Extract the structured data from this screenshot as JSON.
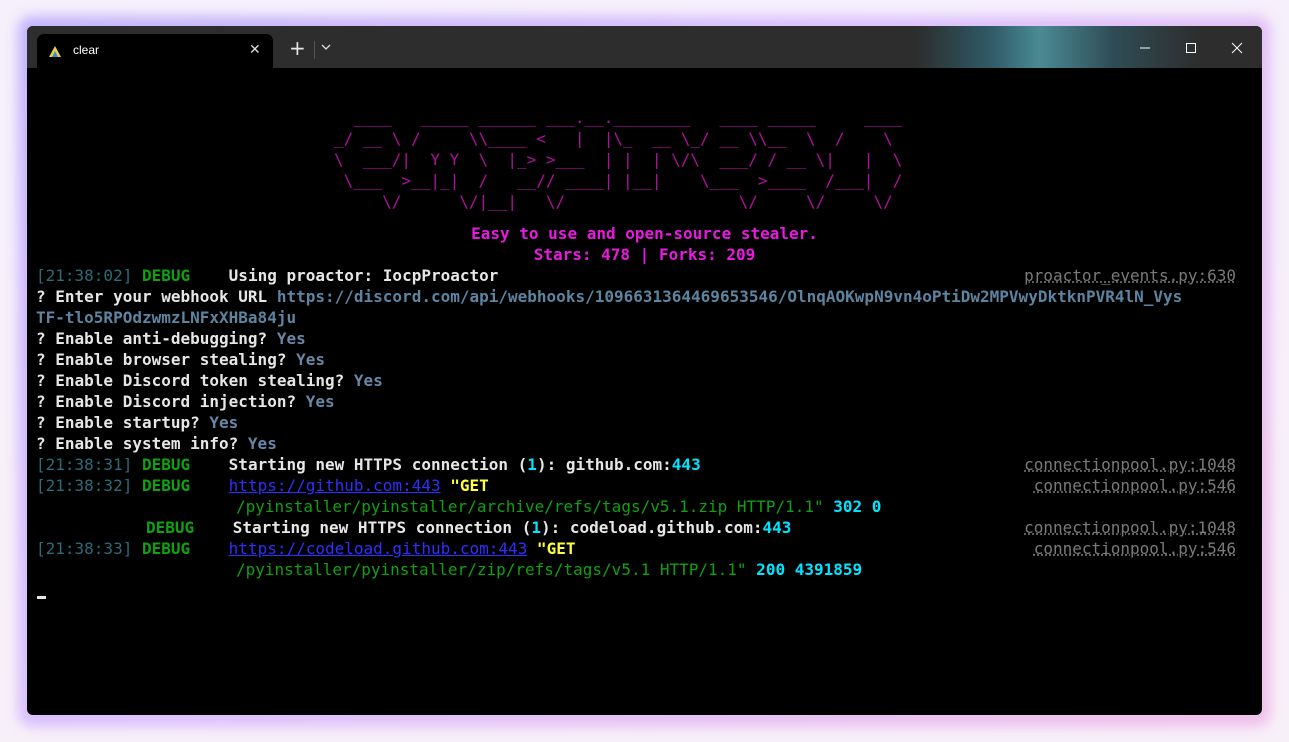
{
  "window": {
    "tab_title": "clear",
    "tab_close": "✕",
    "new_tab": "+"
  },
  "banner": {
    "ascii": [
      "  ____   _____ ______ ___.__.________   ____ _____     ____  ",
      "_/ __ \\ /     \\\\____ <   |  |\\_  __ \\_/ __ \\\\__  \\  /    \\ ",
      "\\  ___/|  Y Y  \\  |_> >___  | |  | \\/\\  ___/ / __ \\|   |  \\",
      " \\___  >__|_|  /   __// ____| |__|    \\___  >____  /___|  /",
      "     \\/      \\/|__|   \\/                  \\/     \\/     \\/ "
    ],
    "tagline": "Easy to use and open-source stealer.",
    "stats": "Stars: 478 | Forks: 209"
  },
  "lines": {
    "l1": {
      "ts": "[21:38:02]",
      "level": "DEBUG",
      "msg": "Using proactor: IocpProactor",
      "src": "proactor_events.py:630"
    },
    "l2": {
      "q": "? Enter your webhook URL ",
      "val": "https://discord.com/api/webhooks/1096631364469653546/OlnqAOKwpN9vn4oPtiDw2MPVwyDktknPVR4lN_Vys"
    },
    "l3": {
      "val": "TF-tlo5RPOdzwmzLNFxXHBa84ju"
    },
    "l4": {
      "q": "? Enable anti-debugging? ",
      "val": "Yes"
    },
    "l5": {
      "q": "? Enable browser stealing? ",
      "val": "Yes"
    },
    "l6": {
      "q": "? Enable Discord token stealing? ",
      "val": "Yes"
    },
    "l7": {
      "q": "? Enable Discord injection? ",
      "val": "Yes"
    },
    "l8": {
      "q": "? Enable startup? ",
      "val": "Yes"
    },
    "l9": {
      "q": "? Enable system info? ",
      "val": "Yes"
    },
    "l10": {
      "ts": "[21:38:31]",
      "level": "DEBUG",
      "msg1": "Starting new HTTPS connection (",
      "n": "1",
      "msg2": "): github.com:",
      "port": "443",
      "src": "connectionpool.py:1048"
    },
    "l11": {
      "ts": "[21:38:32]",
      "level": "DEBUG",
      "link": "https://github.com:443",
      "q": " \"",
      "get": "GET",
      "src": "connectionpool.py:546"
    },
    "l12": {
      "path": "/pyinstaller/pyinstaller/archive/refs/tags/v5.1.zip HTTP/1.1\"",
      "code": " 302 0"
    },
    "l13": {
      "level": "DEBUG",
      "msg1": "Starting new HTTPS connection (",
      "n": "1",
      "msg2": "): codeload.github.com:",
      "port": "443",
      "src": "connectionpool.py:1048"
    },
    "l14": {
      "ts": "[21:38:33]",
      "level": "DEBUG",
      "link": "https://codeload.github.com:443",
      "q": " \"",
      "get": "GET",
      "src": "connectionpool.py:546"
    },
    "l15": {
      "path": "/pyinstaller/pyinstaller/zip/refs/tags/v5.1 HTTP/1.1\"",
      "code": " 200 4391859"
    }
  },
  "colors": {
    "accent": "#e81ae0",
    "debug": "#0fa10f",
    "timestamp": "#2d6b78",
    "answer": "#6a86a6"
  }
}
